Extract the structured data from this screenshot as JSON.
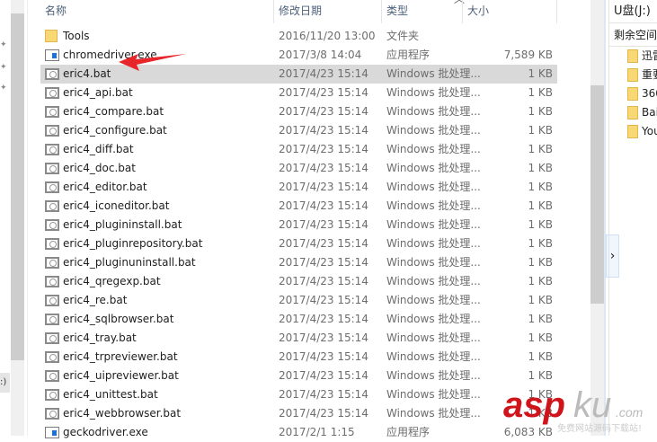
{
  "columns": {
    "name": "名称",
    "date": "修改日期",
    "type": "类型",
    "size": "大小"
  },
  "files": [
    {
      "name": "Tools",
      "date": "2016/11/20 13:00",
      "type": "文件夹",
      "size": "",
      "icon": "folder"
    },
    {
      "name": "chromedriver.exe",
      "date": "2017/3/8 14:04",
      "type": "应用程序",
      "size": "7,589 KB",
      "icon": "exe"
    },
    {
      "name": "eric4.bat",
      "date": "2017/4/23 15:14",
      "type": "Windows 批处理...",
      "size": "1 KB",
      "icon": "bat",
      "selected": true
    },
    {
      "name": "eric4_api.bat",
      "date": "2017/4/23 15:14",
      "type": "Windows 批处理...",
      "size": "1 KB",
      "icon": "bat"
    },
    {
      "name": "eric4_compare.bat",
      "date": "2017/4/23 15:14",
      "type": "Windows 批处理...",
      "size": "1 KB",
      "icon": "bat"
    },
    {
      "name": "eric4_configure.bat",
      "date": "2017/4/23 15:14",
      "type": "Windows 批处理...",
      "size": "1 KB",
      "icon": "bat"
    },
    {
      "name": "eric4_diff.bat",
      "date": "2017/4/23 15:14",
      "type": "Windows 批处理...",
      "size": "1 KB",
      "icon": "bat"
    },
    {
      "name": "eric4_doc.bat",
      "date": "2017/4/23 15:14",
      "type": "Windows 批处理...",
      "size": "1 KB",
      "icon": "bat"
    },
    {
      "name": "eric4_editor.bat",
      "date": "2017/4/23 15:14",
      "type": "Windows 批处理...",
      "size": "1 KB",
      "icon": "bat"
    },
    {
      "name": "eric4_iconeditor.bat",
      "date": "2017/4/23 15:14",
      "type": "Windows 批处理...",
      "size": "1 KB",
      "icon": "bat"
    },
    {
      "name": "eric4_plugininstall.bat",
      "date": "2017/4/23 15:14",
      "type": "Windows 批处理...",
      "size": "1 KB",
      "icon": "bat"
    },
    {
      "name": "eric4_pluginrepository.bat",
      "date": "2017/4/23 15:14",
      "type": "Windows 批处理...",
      "size": "1 KB",
      "icon": "bat"
    },
    {
      "name": "eric4_pluginuninstall.bat",
      "date": "2017/4/23 15:14",
      "type": "Windows 批处理...",
      "size": "1 KB",
      "icon": "bat"
    },
    {
      "name": "eric4_qregexp.bat",
      "date": "2017/4/23 15:14",
      "type": "Windows 批处理...",
      "size": "1 KB",
      "icon": "bat"
    },
    {
      "name": "eric4_re.bat",
      "date": "2017/4/23 15:14",
      "type": "Windows 批处理...",
      "size": "1 KB",
      "icon": "bat"
    },
    {
      "name": "eric4_sqlbrowser.bat",
      "date": "2017/4/23 15:14",
      "type": "Windows 批处理...",
      "size": "1 KB",
      "icon": "bat"
    },
    {
      "name": "eric4_tray.bat",
      "date": "2017/4/23 15:14",
      "type": "Windows 批处理...",
      "size": "1 KB",
      "icon": "bat"
    },
    {
      "name": "eric4_trpreviewer.bat",
      "date": "2017/4/23 15:14",
      "type": "Windows 批处理...",
      "size": "1 KB",
      "icon": "bat"
    },
    {
      "name": "eric4_uipreviewer.bat",
      "date": "2017/4/23 15:14",
      "type": "Windows 批处理...",
      "size": "1 KB",
      "icon": "bat"
    },
    {
      "name": "eric4_unittest.bat",
      "date": "2017/4/23 15:14",
      "type": "Windows 批处理...",
      "size": "1 KB",
      "icon": "bat"
    },
    {
      "name": "eric4_webbrowser.bat",
      "date": "2017/4/23 15:14",
      "type": "Windows 批处理...",
      "size": "1 KB",
      "icon": "bat"
    },
    {
      "name": "geckodriver.exe",
      "date": "2017/2/1 1:15",
      "type": "应用程序",
      "size": "6,083 KB",
      "icon": "exe"
    }
  ],
  "right_pane": {
    "drive": "U盘(J:)",
    "free_space": "剩余空间",
    "folders": [
      "迅雷",
      "重要",
      "360",
      "Bai",
      "You"
    ]
  },
  "left_pane": {
    "selected_label": ":)"
  },
  "watermark": {
    "brand": "aspku",
    "suffix": ".com",
    "tagline": "免费网站源码下载站!"
  },
  "colors": {
    "arrow": "#e8262a",
    "selection": "#d9d9d9",
    "watermark_red": "#d0141b"
  }
}
